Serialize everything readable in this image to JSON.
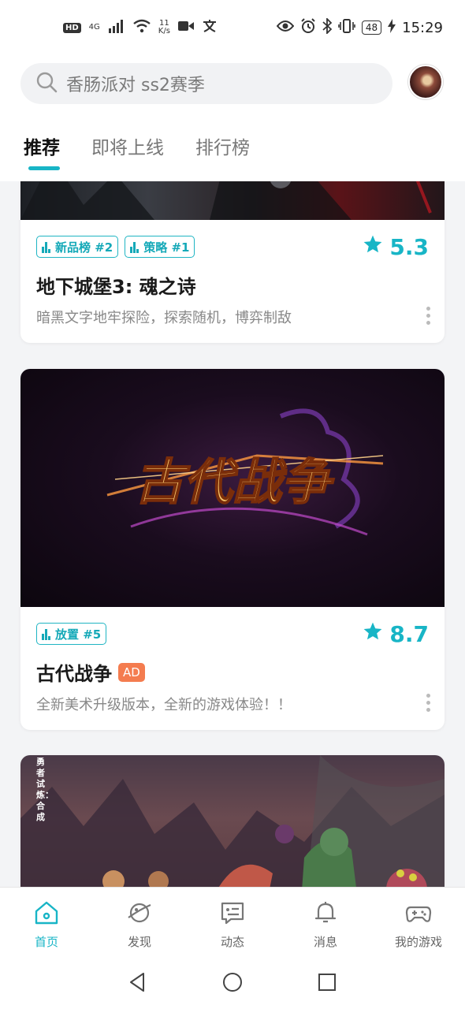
{
  "status_bar": {
    "hd": "HD",
    "net": "4G",
    "speed_value": "11",
    "speed_unit": "K/s",
    "battery": "48",
    "time": "15:29"
  },
  "search": {
    "placeholder": "香肠派对 ss2赛季"
  },
  "tabs": [
    {
      "label": "推荐",
      "active": true
    },
    {
      "label": "即将上线",
      "active": false
    },
    {
      "label": "排行榜",
      "active": false
    }
  ],
  "cards": [
    {
      "tags": [
        "新品榜 #2",
        "策略 #1"
      ],
      "rating": "5.3",
      "title": "地下城堡3: 魂之诗",
      "ad": "",
      "description": "暗黑文字地牢探险，探索随机，博弈制敌"
    },
    {
      "tags": [
        "放置 #5"
      ],
      "rating": "8.7",
      "title": "古代战争",
      "ad": "AD",
      "description": "全新美术升级版本，全新的游戏体验！！",
      "banner_text": "古代战争"
    },
    {
      "banner_side_text": "勇者试炼：合成"
    }
  ],
  "bottom_nav": [
    {
      "label": "首页",
      "icon": "home-icon",
      "active": true
    },
    {
      "label": "发现",
      "icon": "planet-icon",
      "active": false
    },
    {
      "label": "动态",
      "icon": "chat-icon",
      "active": false
    },
    {
      "label": "消息",
      "icon": "bell-icon",
      "active": false
    },
    {
      "label": "我的游戏",
      "icon": "gamepad-icon",
      "active": false
    }
  ],
  "colors": {
    "accent": "#18b5c6",
    "ad": "#f47c4f"
  }
}
